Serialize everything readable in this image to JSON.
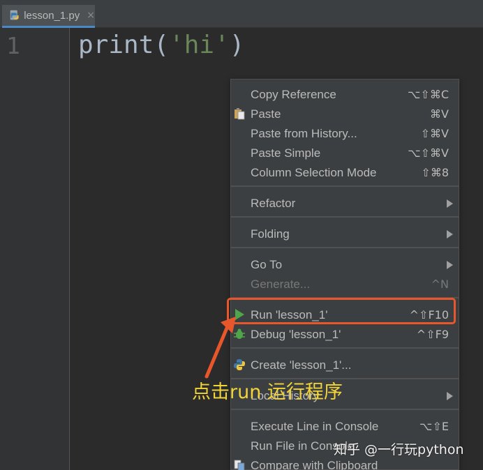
{
  "editor": {
    "tab": {
      "label": "lesson_1.py",
      "close": "×",
      "icon": "python-file-icon"
    },
    "line_numbers": [
      "1"
    ],
    "code": {
      "fn": "print",
      "open": "(",
      "str": "'hi'",
      "close": ")"
    }
  },
  "context_menu": {
    "items": [
      {
        "label": "Copy Reference",
        "shortcut": "⌥⇧⌘C"
      },
      {
        "label": "Paste",
        "shortcut": "⌘V",
        "icon": "clipboard-icon"
      },
      {
        "label": "Paste from History...",
        "shortcut": "⇧⌘V"
      },
      {
        "label": "Paste Simple",
        "shortcut": "⌥⇧⌘V"
      },
      {
        "label": "Column Selection Mode",
        "shortcut": "⇧⌘8"
      },
      {
        "label": "Refactor",
        "submenu": true
      },
      {
        "label": "Folding",
        "submenu": true
      },
      {
        "label": "Go To",
        "submenu": true
      },
      {
        "label": "Generate...",
        "shortcut": "^N",
        "disabled": true
      },
      {
        "label": "Run 'lesson_1'",
        "shortcut": "^⇧F10",
        "icon": "run-play-icon"
      },
      {
        "label": "Debug 'lesson_1'",
        "shortcut": "^⇧F9",
        "icon": "debug-bug-icon"
      },
      {
        "label": "Create 'lesson_1'...",
        "icon": "python-logo-icon"
      },
      {
        "label": "Local History",
        "submenu": true
      },
      {
        "label": "Execute Line in Console",
        "shortcut": "⌥⇧E"
      },
      {
        "label": "Run File in Console"
      },
      {
        "label": "Compare with Clipboard",
        "icon": "compare-icon"
      }
    ]
  },
  "annotation": {
    "text": "点击run 运行程序",
    "color": "#f2d438",
    "highlight_color": "#e8572c"
  },
  "watermark": {
    "text": "知乎 @一行玩python"
  }
}
